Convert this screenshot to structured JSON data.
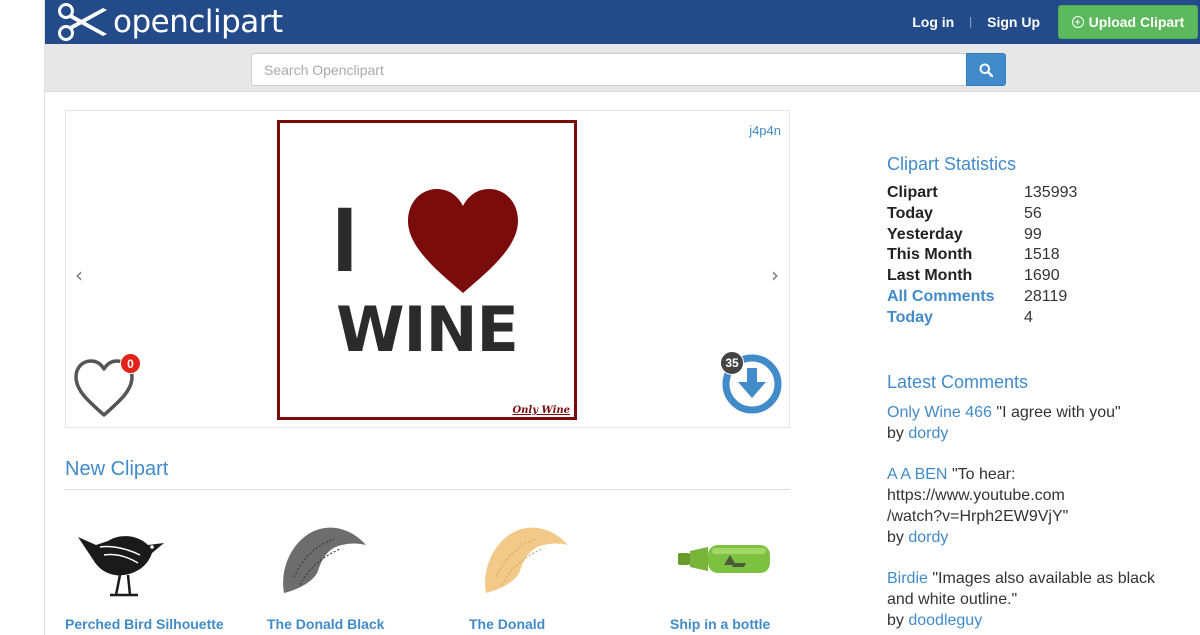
{
  "header": {
    "brand": "openclipart",
    "login_label": "Log in",
    "separator": "|",
    "signup_label": "Sign Up",
    "upload_label": "Upload Clipart",
    "bg_color": "#234a89",
    "upload_color": "#5cb85c"
  },
  "search": {
    "placeholder": "Search Openclipart",
    "value": ""
  },
  "featured": {
    "author": "j4p4n",
    "image_text": {
      "line1_letter": "I",
      "line2": "WINE",
      "brand": "Only Wine"
    },
    "favorites_count": "0",
    "downloads_count": "35",
    "prev_label": "‹",
    "next_label": "›"
  },
  "new_clipart": {
    "title": "New Clipart",
    "items": [
      {
        "label": "Perched Bird Silhouette",
        "icon": "bird-icon"
      },
      {
        "label": "The Donald Black",
        "icon": "hair-black-icon"
      },
      {
        "label": "The Donald",
        "icon": "hair-blonde-icon"
      },
      {
        "label": "Ship in a bottle",
        "icon": "bottle-icon"
      }
    ]
  },
  "sidebar": {
    "stats_title": "Clipart Statistics",
    "stats": [
      {
        "label": "Clipart",
        "value": "135993",
        "link": false
      },
      {
        "label": "Today",
        "value": "56",
        "link": false
      },
      {
        "label": "Yesterday",
        "value": "99",
        "link": false
      },
      {
        "label": "This Month",
        "value": "1518",
        "link": false
      },
      {
        "label": "Last Month",
        "value": "1690",
        "link": false
      },
      {
        "label": "All Comments",
        "value": "28119",
        "link": true
      },
      {
        "label": "Today",
        "value": "4",
        "link": true
      }
    ],
    "comments_title": "Latest Comments",
    "comments": [
      {
        "item": "Only Wine 466",
        "text": "\"I agree with you\"",
        "by": "by",
        "user": "dordy"
      },
      {
        "item": "A A BEN",
        "text_lines": [
          "\"To hear:",
          "https://www.youtube.com",
          "/watch?v=Hrph2EW9VjY\""
        ],
        "by": "by",
        "user": "dordy"
      },
      {
        "item": "Birdie",
        "text_lines": [
          "\"Images also available as black",
          "and white outline.\""
        ],
        "by": "by",
        "user": "doodleguy"
      }
    ]
  }
}
